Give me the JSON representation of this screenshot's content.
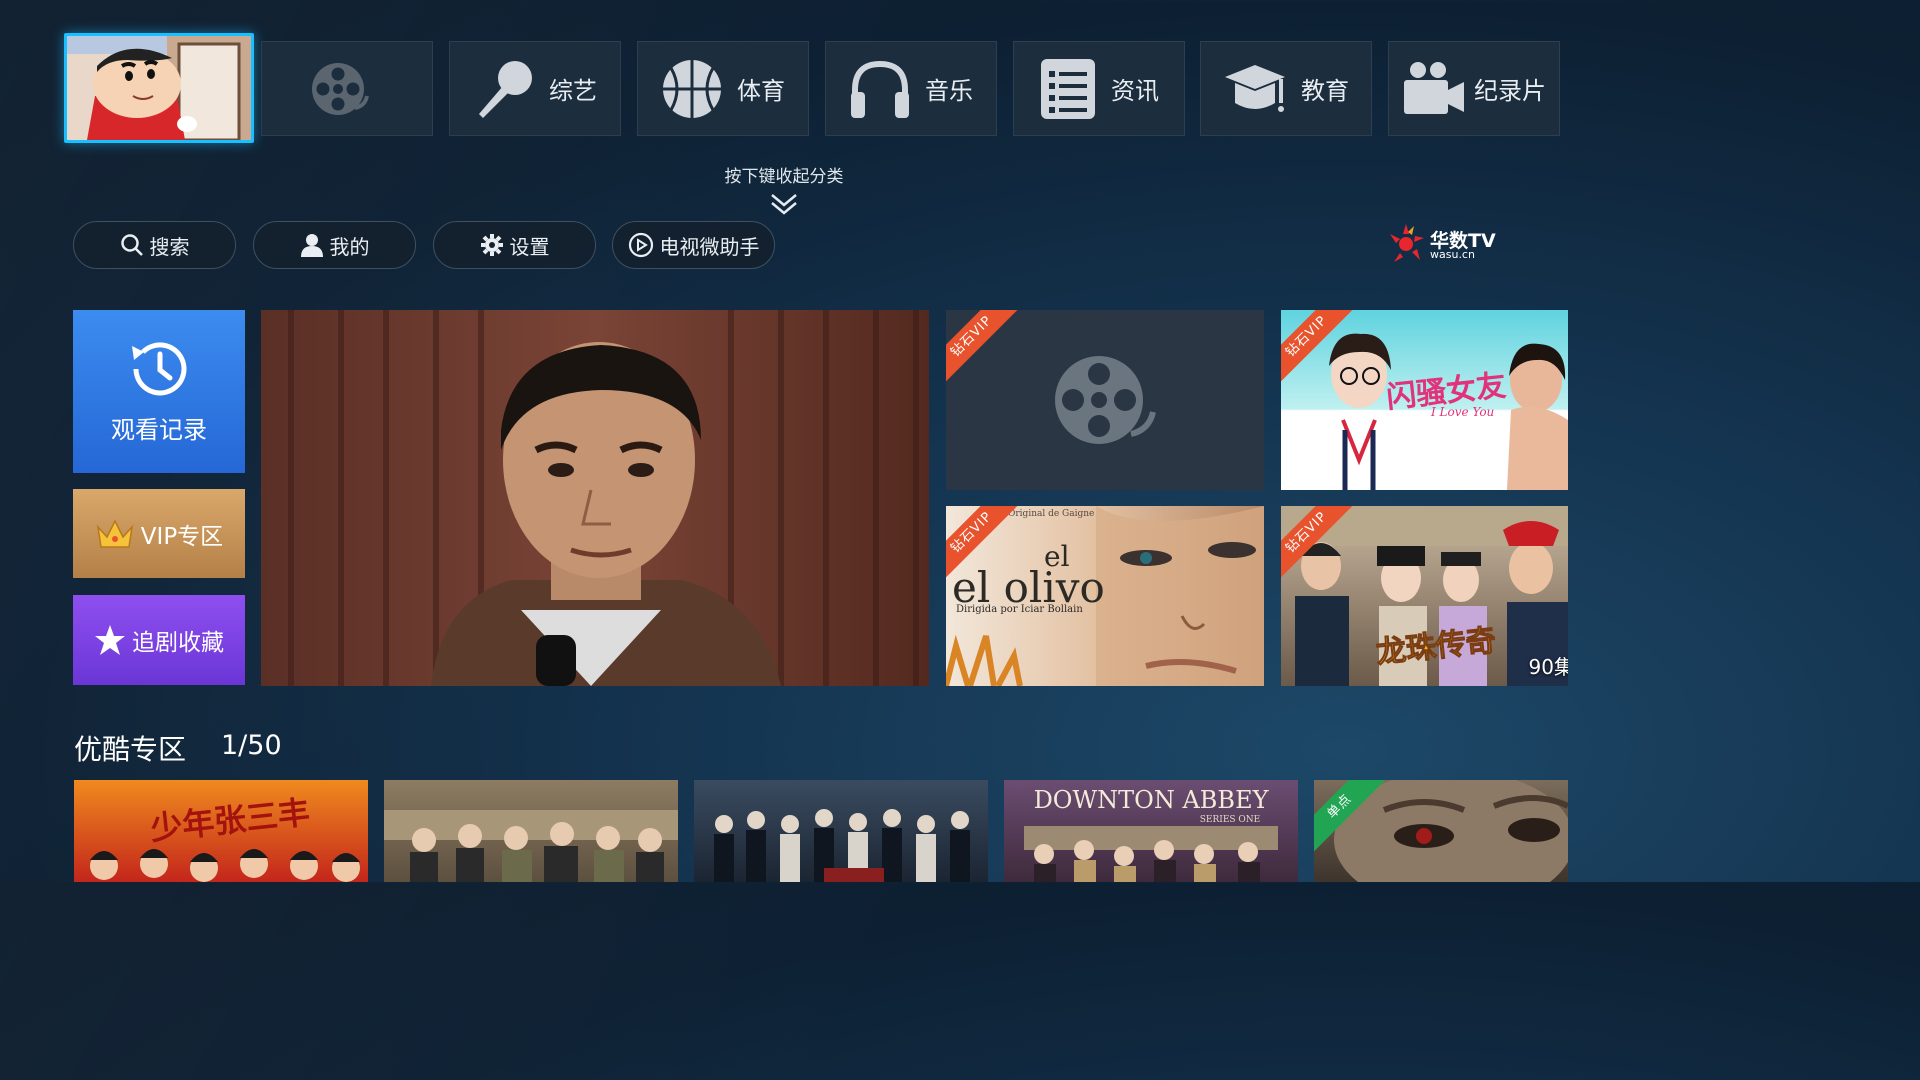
{
  "categories": [
    {
      "label": "",
      "icon": "cartoon-thumbnail"
    },
    {
      "label": "",
      "icon": "film-reel-icon"
    },
    {
      "label": "综艺",
      "icon": "microphone-icon"
    },
    {
      "label": "体育",
      "icon": "basketball-icon"
    },
    {
      "label": "音乐",
      "icon": "headphones-icon"
    },
    {
      "label": "资讯",
      "icon": "news-list-icon"
    },
    {
      "label": "教育",
      "icon": "graduation-cap-icon"
    },
    {
      "label": "纪录片",
      "icon": "video-camera-icon"
    }
  ],
  "collapse_hint": "按下键收起分类",
  "actions": [
    {
      "label": "搜索",
      "icon": "search-icon"
    },
    {
      "label": "我的",
      "icon": "user-icon"
    },
    {
      "label": "设置",
      "icon": "gear-icon"
    },
    {
      "label": "电视微助手",
      "icon": "play-circle-icon"
    }
  ],
  "logo": {
    "brand": "华数TV",
    "sub": "wasu.cn"
  },
  "side": {
    "history": "观看记录",
    "vip": "VIP专区",
    "favorites": "追剧收藏"
  },
  "posters": [
    {
      "badge": "钻石VIP",
      "title": ""
    },
    {
      "badge": "钻石VIP",
      "title": "闪骚女友",
      "subtitle": "I Love You"
    },
    {
      "badge": "钻石VIP",
      "title": "el olivo",
      "top_text": "Original de Gaigne",
      "credit": "Dirigida por Iciar Bollain"
    },
    {
      "badge": "钻石VIP",
      "title": "龙珠传奇",
      "episodes": "90集"
    }
  ],
  "section": {
    "title": "优酷专区",
    "count": "1/50"
  },
  "bottom_cards": [
    {
      "title": "少年张三丰"
    },
    {
      "title": ""
    },
    {
      "title": ""
    },
    {
      "title": "DOWNTON ABBEY",
      "subtitle": "SERIES ONE"
    },
    {
      "badge": "单点"
    }
  ],
  "colors": {
    "focus": "#19c0ff",
    "vip_badge": "#e8532d",
    "single_badge": "#22a553",
    "history": "#2f78e4",
    "vip": "#c8945a",
    "favorites": "#7d42e4"
  }
}
